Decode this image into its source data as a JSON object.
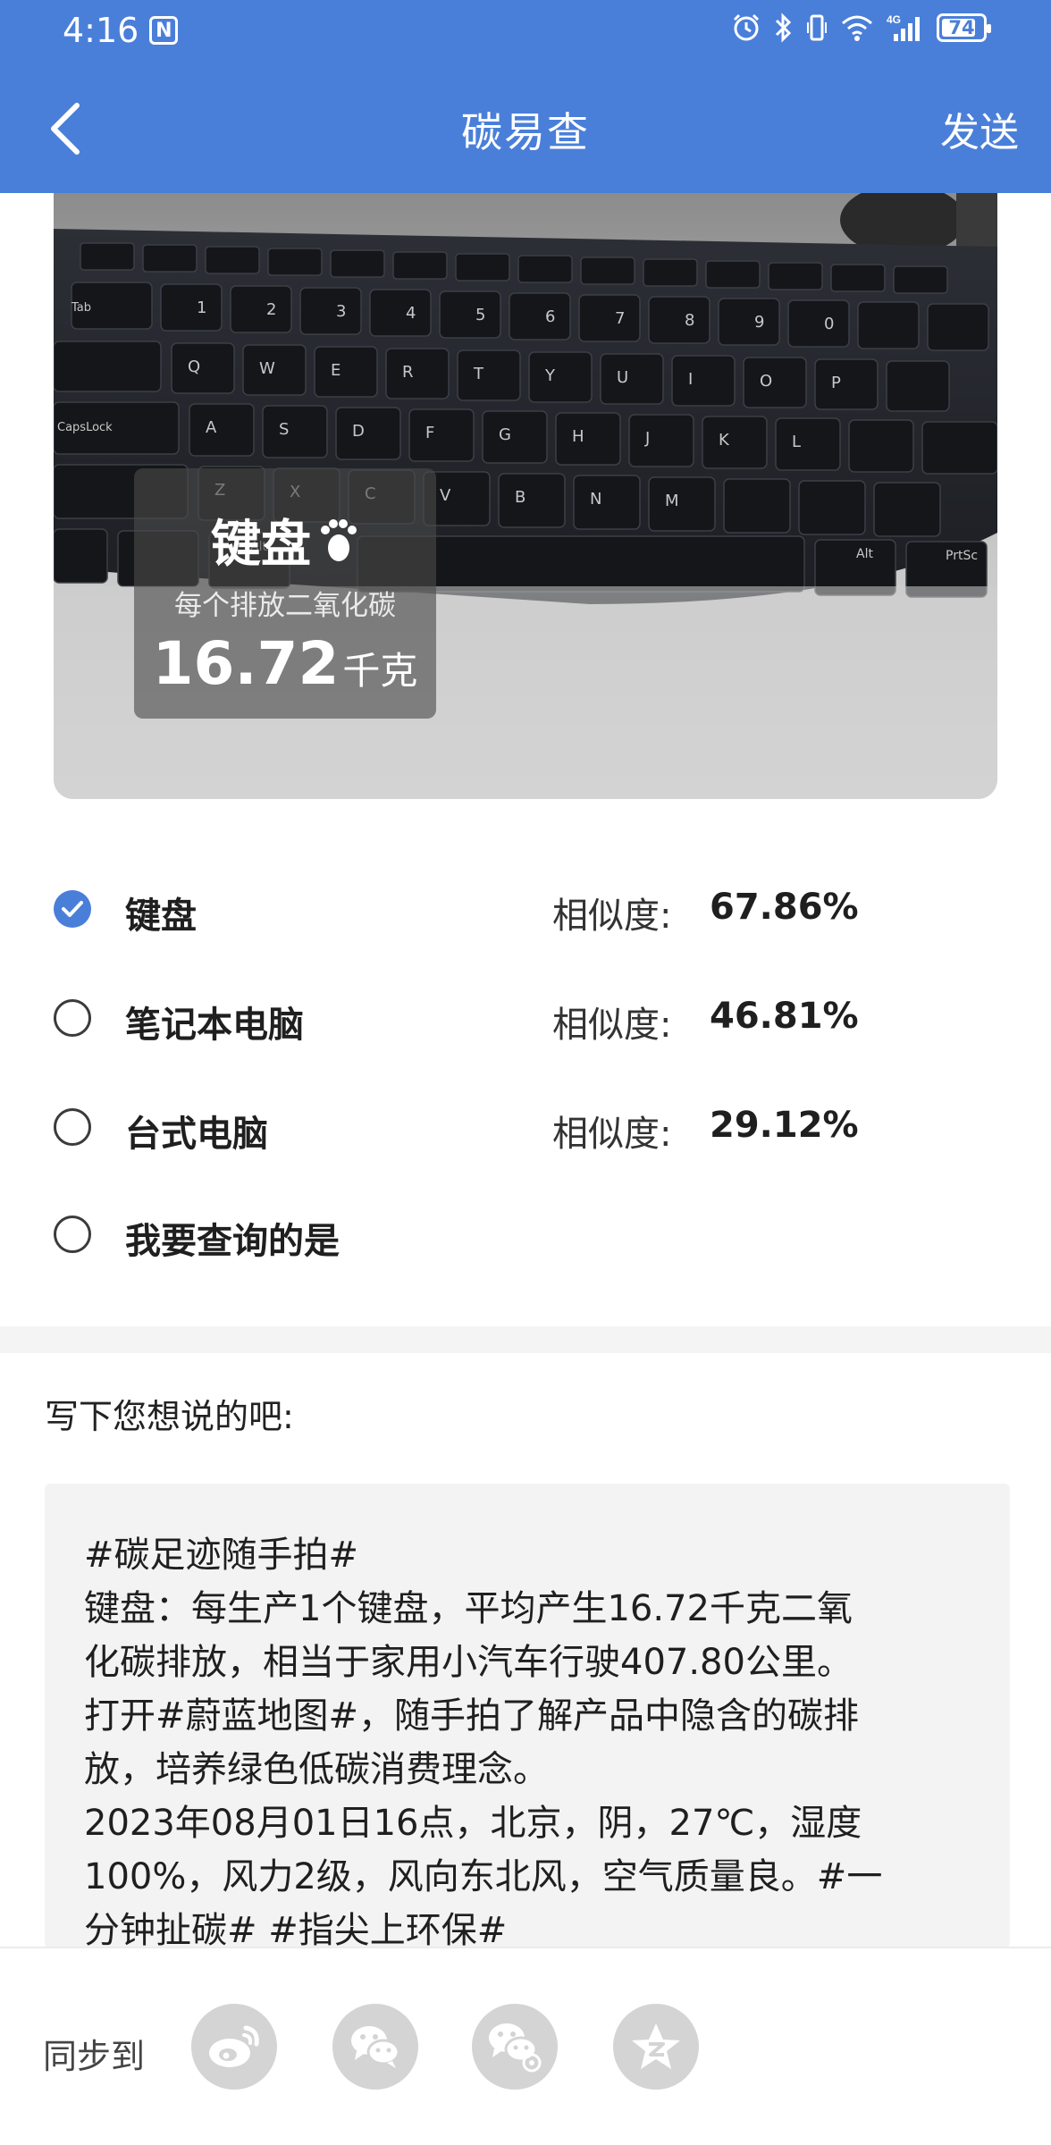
{
  "status_bar": {
    "time": "4:16",
    "battery": "74"
  },
  "nav": {
    "title": "碳易查",
    "send_label": "发送"
  },
  "photo": {
    "item_name": "键盘",
    "sub_label": "每个排放二氧化碳",
    "value": "16.72",
    "unit": "千克"
  },
  "options": [
    {
      "label": "键盘",
      "similarity_label": "相似度:",
      "similarity": "67.86%",
      "selected": true
    },
    {
      "label": "笔记本电脑",
      "similarity_label": "相似度:",
      "similarity": "46.81%",
      "selected": false
    },
    {
      "label": "台式电脑",
      "similarity_label": "相似度:",
      "similarity": "29.12%",
      "selected": false
    },
    {
      "label": "我要查询的是",
      "selected": false
    }
  ],
  "compose": {
    "prompt": "写下您想说的吧:",
    "lines": [
      "#碳足迹随手拍#",
      "键盘：每生产1个键盘，平均产生16.72千克二氧",
      "化碳排放，相当于家用小汽车行驶407.80公里。",
      "打开#蔚蓝地图#，随手拍了解产品中隐含的碳排",
      "放，培养绿色低碳消费理念。",
      "2023年08月01日16点，北京，阴，27℃，湿度",
      "100%，风力2级，风向东北风，空气质量良。#一",
      "分钟扯碳# #指尖上环保#"
    ]
  },
  "share": {
    "label": "同步到",
    "targets": [
      "weibo-icon",
      "wechat-icon",
      "wechat-moments-icon",
      "qzone-icon"
    ]
  },
  "colors": {
    "accent": "#4a7fd9",
    "share_icon_bg": "#d4d4d4"
  }
}
